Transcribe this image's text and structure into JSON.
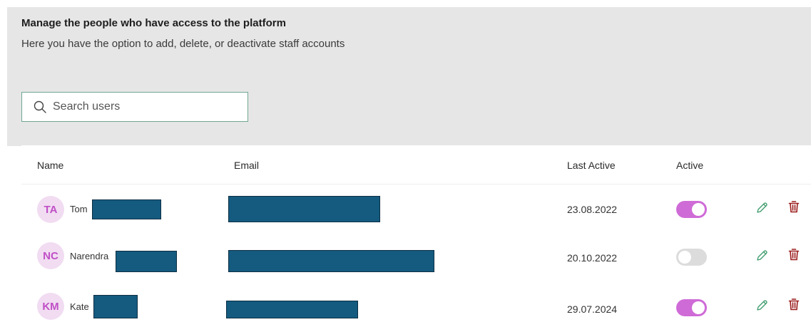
{
  "header": {
    "title": "Manage the people who have access to the platform",
    "subtitle": "Here you have the option to add, delete, or deactivate staff accounts"
  },
  "search": {
    "placeholder": "Search users",
    "icon": "search-icon"
  },
  "table": {
    "columns": {
      "name": "Name",
      "email": "Email",
      "last_active": "Last Active",
      "active": "Active"
    },
    "rows": [
      {
        "initials": "TA",
        "name": "Tom",
        "last_active": "23.08.2022",
        "active": true
      },
      {
        "initials": "NC",
        "name": "Narendra",
        "last_active": "20.10.2022",
        "active": false
      },
      {
        "initials": "KM",
        "name": "Kate",
        "last_active": "29.07.2024",
        "active": true
      }
    ]
  },
  "colors": {
    "accent_toggle": "#cf6bd7",
    "avatar_bg": "#f1dcf2",
    "avatar_text": "#c04fc6",
    "edit_icon": "#3a9a6a",
    "delete_icon": "#9b1c1c",
    "search_border": "#6fa791"
  },
  "icons": {
    "edit": "pencil-icon",
    "delete": "trash-icon"
  }
}
